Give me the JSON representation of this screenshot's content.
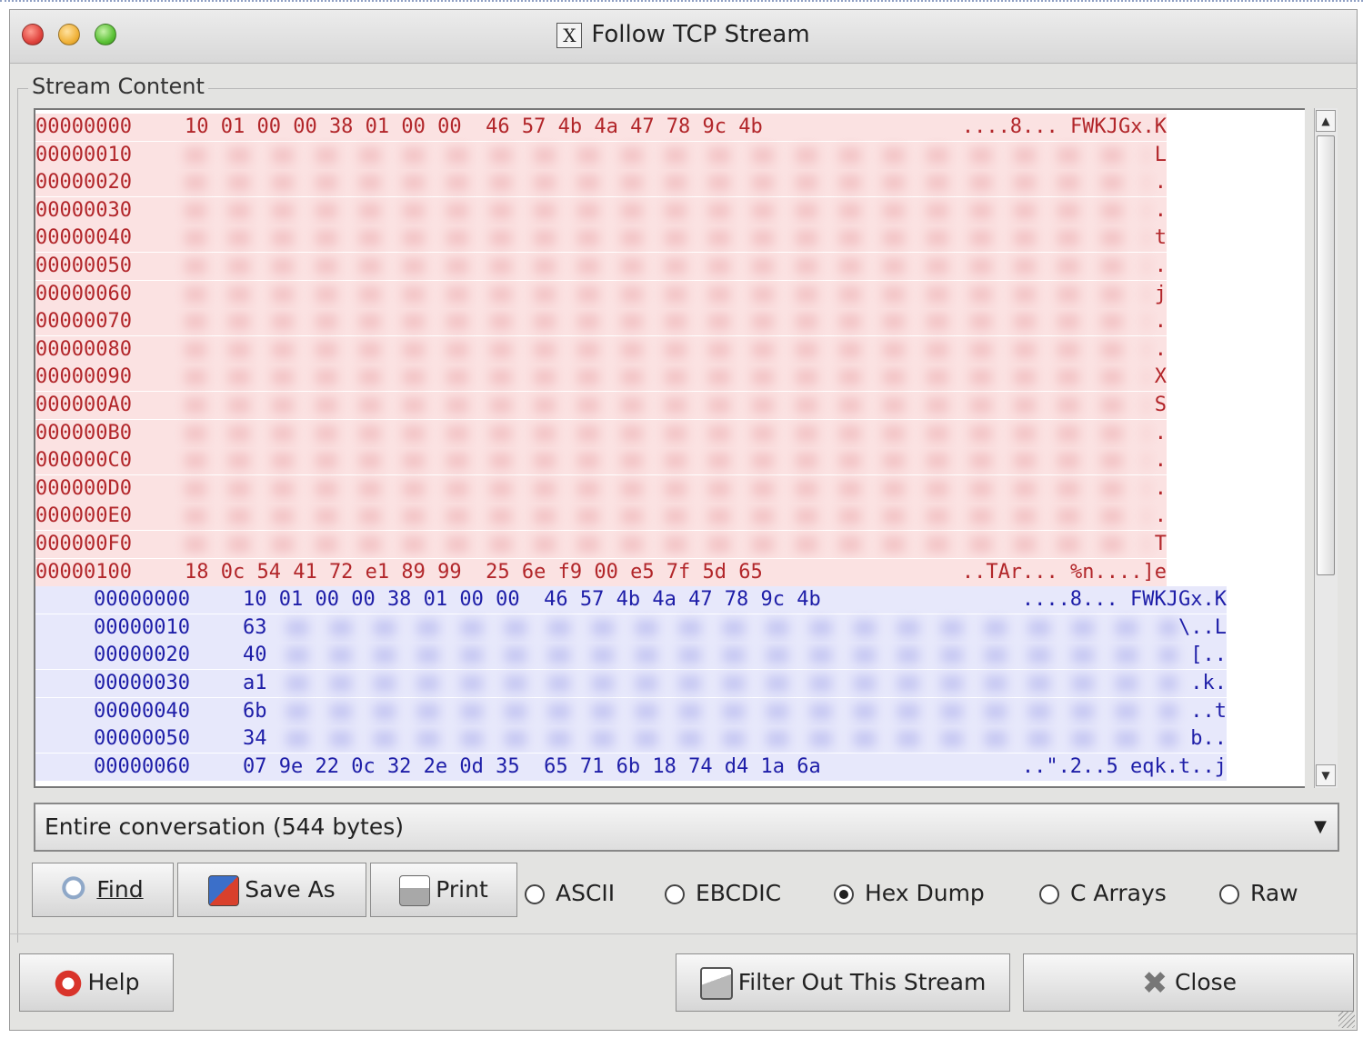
{
  "window": {
    "title": "Follow TCP Stream",
    "x_icon_glyph": "X"
  },
  "frame_label": "Stream Content",
  "client_rows": [
    {
      "offset": "00000000",
      "hex": "10 01 00 00 38 01 00 00  46 57 4b 4a 47 78 9c 4b",
      "ascii": "....8... FWKJGx.K",
      "blur": false
    },
    {
      "offset": "00000010",
      "hex": "",
      "ascii": "L",
      "blur": true
    },
    {
      "offset": "00000020",
      "hex": "",
      "ascii": ".",
      "blur": true
    },
    {
      "offset": "00000030",
      "hex": "",
      "ascii": ".",
      "blur": true
    },
    {
      "offset": "00000040",
      "hex": "",
      "ascii": "t",
      "blur": true
    },
    {
      "offset": "00000050",
      "hex": "",
      "ascii": ".",
      "blur": true
    },
    {
      "offset": "00000060",
      "hex": "",
      "ascii": "j",
      "blur": true
    },
    {
      "offset": "00000070",
      "hex": "",
      "ascii": ".",
      "blur": true
    },
    {
      "offset": "00000080",
      "hex": "",
      "ascii": ".",
      "blur": true
    },
    {
      "offset": "00000090",
      "hex": "",
      "ascii": "X",
      "blur": true
    },
    {
      "offset": "000000A0",
      "hex": "",
      "ascii": "S",
      "blur": true
    },
    {
      "offset": "000000B0",
      "hex": "",
      "ascii": ".",
      "blur": true
    },
    {
      "offset": "000000C0",
      "hex": "",
      "ascii": ".",
      "blur": true
    },
    {
      "offset": "000000D0",
      "hex": "",
      "ascii": ".",
      "blur": true
    },
    {
      "offset": "000000E0",
      "hex": "",
      "ascii": ".",
      "blur": true
    },
    {
      "offset": "000000F0",
      "hex": "",
      "ascii": "T",
      "blur": true
    },
    {
      "offset": "00000100",
      "hex": "18 0c 54 41 72 e1 89 99  25 6e f9 00 e5 7f 5d 65",
      "ascii": "..TAr... %n....]e",
      "blur": false
    }
  ],
  "server_rows": [
    {
      "offset": "00000000",
      "hex": "10 01 00 00 38 01 00 00  46 57 4b 4a 47 78 9c 4b",
      "ascii": "....8... FWKJGx.K",
      "blur": false
    },
    {
      "offset": "00000010",
      "hex": "63",
      "ascii": "\\..L",
      "blur": true
    },
    {
      "offset": "00000020",
      "hex": "40",
      "ascii": "[..",
      "blur": true
    },
    {
      "offset": "00000030",
      "hex": "a1",
      "ascii": ".k.",
      "blur": true
    },
    {
      "offset": "00000040",
      "hex": "6b",
      "ascii": "..t",
      "blur": true
    },
    {
      "offset": "00000050",
      "hex": "34",
      "ascii": "b..",
      "blur": true
    },
    {
      "offset": "00000060",
      "hex": "07 9e 22 0c 32 2e 0d 35  65 71 6b 18 74 d4 1a 6a",
      "ascii": "..\".2..5 eqk.t..j",
      "blur": false
    }
  ],
  "conversation_select": {
    "value": "Entire conversation (544 bytes)"
  },
  "buttons": {
    "find": "Find",
    "save_as": "Save As",
    "print": "Print",
    "help": "Help",
    "filter_out": "Filter Out This Stream",
    "close": "Close"
  },
  "format_options": [
    {
      "label": "ASCII",
      "selected": false
    },
    {
      "label": "EBCDIC",
      "selected": false
    },
    {
      "label": "Hex Dump",
      "selected": true
    },
    {
      "label": "C Arrays",
      "selected": false
    },
    {
      "label": "Raw",
      "selected": false
    }
  ],
  "colors": {
    "client_bg": "#fbe2e2",
    "client_fg": "#b2262a",
    "server_bg": "#e7e8fb",
    "server_fg": "#1e1ea8"
  }
}
